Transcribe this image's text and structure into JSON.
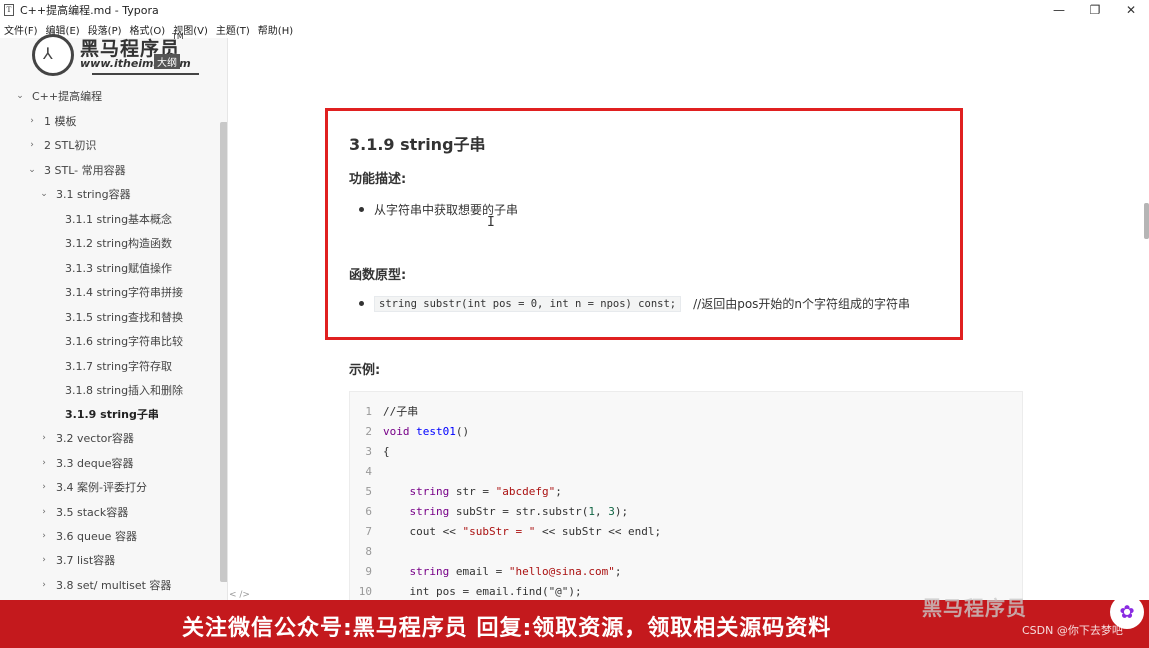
{
  "window": {
    "title": "C++提高编程.md - Typora",
    "app_icon": "T",
    "minimize": "—",
    "maximize": "❐",
    "close": "✕"
  },
  "menu": [
    "文件(F)",
    "编辑(E)",
    "段落(P)",
    "格式(O)",
    "视图(V)",
    "主题(T)",
    "帮助(H)"
  ],
  "logo": {
    "brand": "黑马程序员",
    "tm": "TM",
    "url": "www.itheima.com",
    "tag": "大纲",
    "icon": "logo-icon"
  },
  "sidebar": {
    "items": [
      {
        "label": "C++提高编程",
        "chev": "⌄",
        "level": 0
      },
      {
        "label": "1 模板",
        "chev": "›",
        "level": 1
      },
      {
        "label": "2 STL初识",
        "chev": "›",
        "level": 1
      },
      {
        "label": "3 STL- 常用容器",
        "chev": "⌄",
        "level": 1
      },
      {
        "label": "3.1 string容器",
        "chev": "⌄",
        "level": 2
      },
      {
        "label": "3.1.1 string基本概念",
        "chev": "",
        "level": 3
      },
      {
        "label": "3.1.2 string构造函数",
        "chev": "",
        "level": 3
      },
      {
        "label": "3.1.3 string赋值操作",
        "chev": "",
        "level": 3
      },
      {
        "label": "3.1.4 string字符串拼接",
        "chev": "",
        "level": 3
      },
      {
        "label": "3.1.5 string查找和替换",
        "chev": "",
        "level": 3
      },
      {
        "label": "3.1.6 string字符串比较",
        "chev": "",
        "level": 3
      },
      {
        "label": "3.1.7 string字符存取",
        "chev": "",
        "level": 3
      },
      {
        "label": "3.1.8 string插入和删除",
        "chev": "",
        "level": 3
      },
      {
        "label": "3.1.9 string子串",
        "chev": "",
        "level": 3,
        "active": true
      },
      {
        "label": "3.2 vector容器",
        "chev": "›",
        "level": 2
      },
      {
        "label": "3.3 deque容器",
        "chev": "›",
        "level": 2
      },
      {
        "label": "3.4 案例-评委打分",
        "chev": "›",
        "level": 2
      },
      {
        "label": "3.5 stack容器",
        "chev": "›",
        "level": 2
      },
      {
        "label": "3.6 queue 容器",
        "chev": "›",
        "level": 2
      },
      {
        "label": "3.7 list容器",
        "chev": "›",
        "level": 2
      },
      {
        "label": "3.8 set/ multiset 容器",
        "chev": "›",
        "level": 2
      }
    ]
  },
  "doc": {
    "heading": "3.1.9 string子串",
    "func_desc_title": "功能描述:",
    "func_desc_item": "从字符串中获取想要的子串",
    "proto_title": "函数原型:",
    "proto_code": "string substr(int pos = 0, int n = npos) const;",
    "proto_comment": "//返回由pos开始的n个字符组成的字符串",
    "example_title": "示例:",
    "code_lines": [
      {
        "n": "1",
        "text": "//子串"
      },
      {
        "n": "2",
        "text": "void test01()"
      },
      {
        "n": "3",
        "text": "{"
      },
      {
        "n": "4",
        "text": ""
      },
      {
        "n": "5",
        "text": "    string str = \"abcdefg\";"
      },
      {
        "n": "6",
        "text": "    string subStr = str.substr(1, 3);"
      },
      {
        "n": "7",
        "text": "    cout << \"subStr = \" << subStr << endl;"
      },
      {
        "n": "8",
        "text": ""
      },
      {
        "n": "9",
        "text": "    string email = \"hello@sina.com\";"
      },
      {
        "n": "10",
        "text": "    int pos = email.find(\"@\");"
      }
    ]
  },
  "bottom_hint": "<  />",
  "banner": {
    "text": "关注微信公众号:黑马程序员  回复:领取资源，领取相关源码资料",
    "watermark_brand": "黑马程序员",
    "watermark_site": "CSDN @你下去梦吧",
    "avatar_icon": "brain-icon"
  },
  "colors": {
    "highlight_border": "#e02020",
    "banner_bg": "#c4191d"
  }
}
